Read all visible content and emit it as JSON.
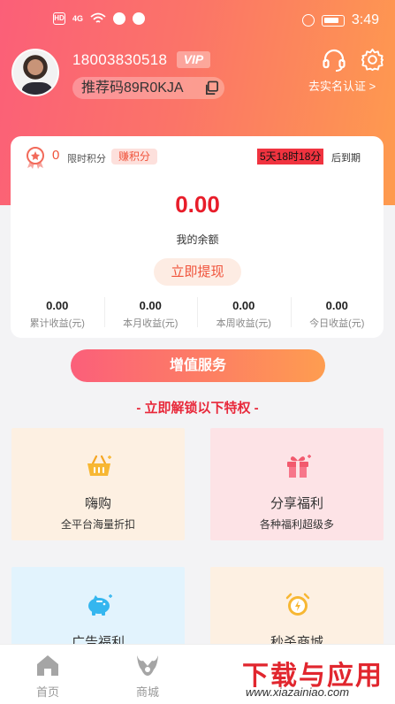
{
  "status_bar": {
    "time": "3:49",
    "hd_badge": "HD",
    "signal_label": "4G"
  },
  "profile": {
    "phone": "18003830518",
    "vip_badge": "VIP",
    "referral_code": "推荐码89R0KJA",
    "realname_link": "去实名认证 >"
  },
  "points": {
    "value": "0",
    "label": "限时积分",
    "earn_button": "赚积分",
    "countdown": "5天18时18分",
    "expire_label": "后到期"
  },
  "wallet": {
    "balance": "0.00",
    "balance_label": "我的余额",
    "withdraw_button": "立即提现"
  },
  "stats": [
    {
      "value": "0.00",
      "label": "累计收益(元)"
    },
    {
      "value": "0.00",
      "label": "本月收益(元)"
    },
    {
      "value": "0.00",
      "label": "本周收益(元)"
    },
    {
      "value": "0.00",
      "label": "今日收益(元)"
    }
  ],
  "value_added_button": "增值服务",
  "unlock_heading": "- 立即解锁以下特权 -",
  "privileges": [
    {
      "title": "嗨购",
      "subtitle": "全平台海量折扣",
      "icon": "basket-icon"
    },
    {
      "title": "分享福利",
      "subtitle": "各种福利超级多",
      "icon": "gift-icon"
    },
    {
      "title": "广告福利",
      "subtitle": "",
      "icon": "piggy-bank-icon"
    },
    {
      "title": "秒杀商城",
      "subtitle": "",
      "icon": "alarm-clock-icon"
    }
  ],
  "tabbar": {
    "home": "首页",
    "mall": "商城"
  },
  "watermark": {
    "main": "下载与应用",
    "sub": "www.xiazainiao.com"
  },
  "colors": {
    "header_start": "#fb5f78",
    "header_end": "#fe9b4e",
    "accent_red": "#e81d2a",
    "countdown_bg": "#f0333f"
  }
}
